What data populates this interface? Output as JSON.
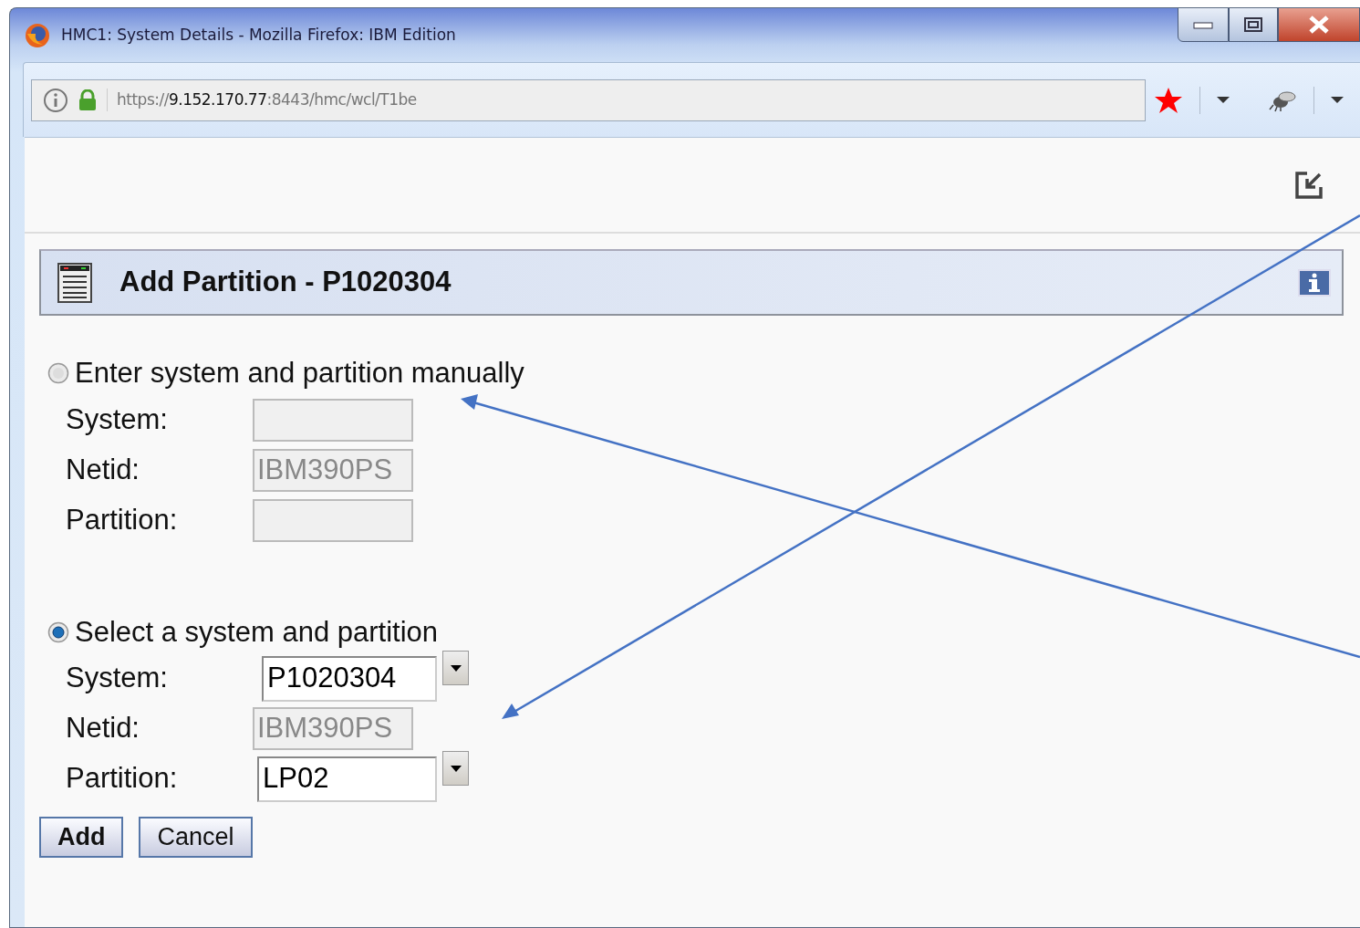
{
  "window": {
    "title": "HMC1: System Details - Mozilla Firefox: IBM Edition"
  },
  "address_bar": {
    "url": "https://**9.152.170.77**:8443/hmc/wcl/T1be"
  },
  "dialog": {
    "title": "Add Partition - P1020304"
  },
  "options": [
    {
      "label": "Enter system and partition manually",
      "selected": false,
      "fields": [
        {
          "label": "System:",
          "kind": "text",
          "disabled": true
        },
        {
          "label": "Netid:",
          "kind": "text",
          "disabled": true,
          "value": "IBM390PS"
        },
        {
          "label": "Partition:",
          "kind": "text",
          "disabled": true
        }
      ]
    },
    {
      "label": "Select a system and partition",
      "selected": true,
      "fields": [
        {
          "label": "System:",
          "kind": "select",
          "disabled": false,
          "value": "P1020304"
        },
        {
          "label": "Netid:",
          "kind": "text",
          "disabled": true,
          "value": "IBM390PS"
        },
        {
          "label": "Partition:",
          "kind": "select",
          "disabled": false,
          "value": "LP02"
        }
      ]
    }
  ],
  "buttons": [
    {
      "label": "Add",
      "default": true
    },
    {
      "label": "Cancel",
      "default": false
    }
  ]
}
